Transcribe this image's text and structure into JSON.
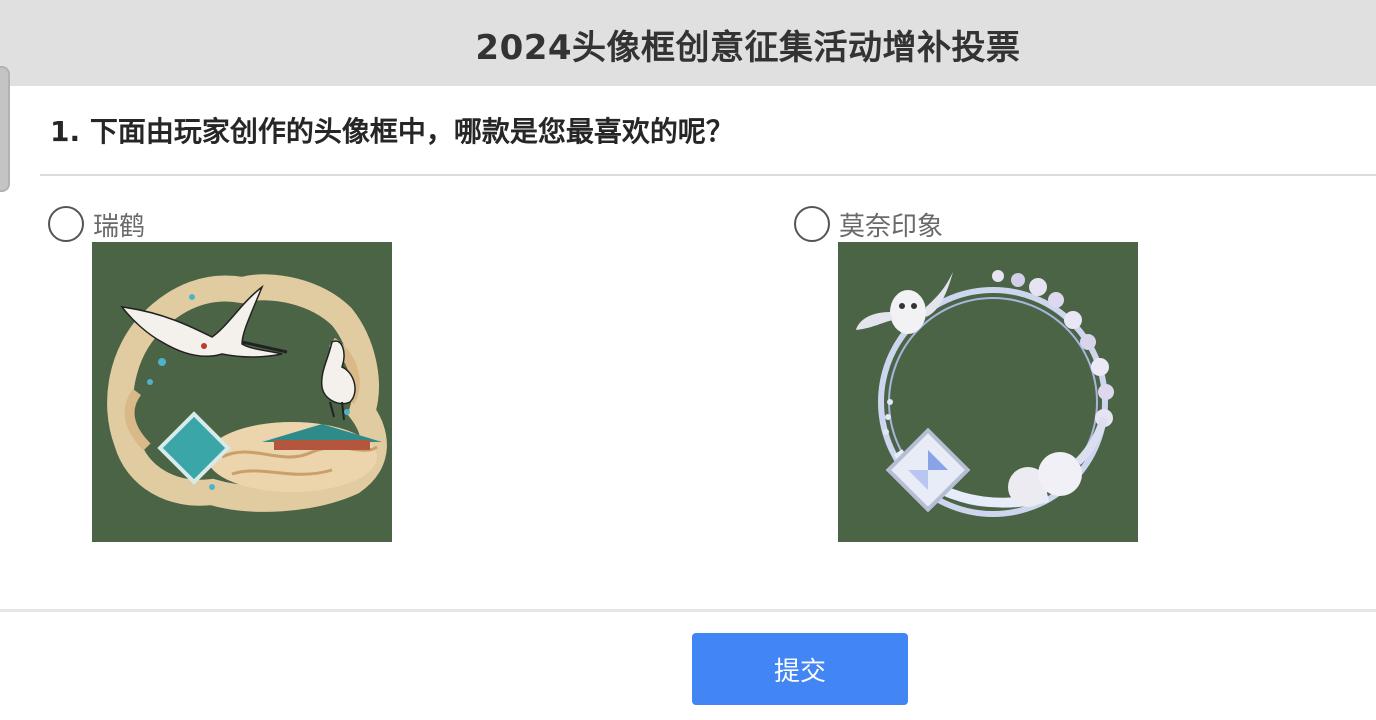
{
  "header": {
    "title": "2024头像框创意征集活动增补投票"
  },
  "question": {
    "text": "1. 下面由玩家创作的头像框中，哪款是您最喜欢的呢？"
  },
  "options": [
    {
      "label": "瑞鹤",
      "selected": false
    },
    {
      "label": "莫奈印象",
      "selected": false
    }
  ],
  "footer": {
    "submit_label": "提交"
  },
  "colors": {
    "header_bg": "#e0e0e0",
    "image_bg": "#4b6446",
    "submit_bg": "#4285f4"
  }
}
